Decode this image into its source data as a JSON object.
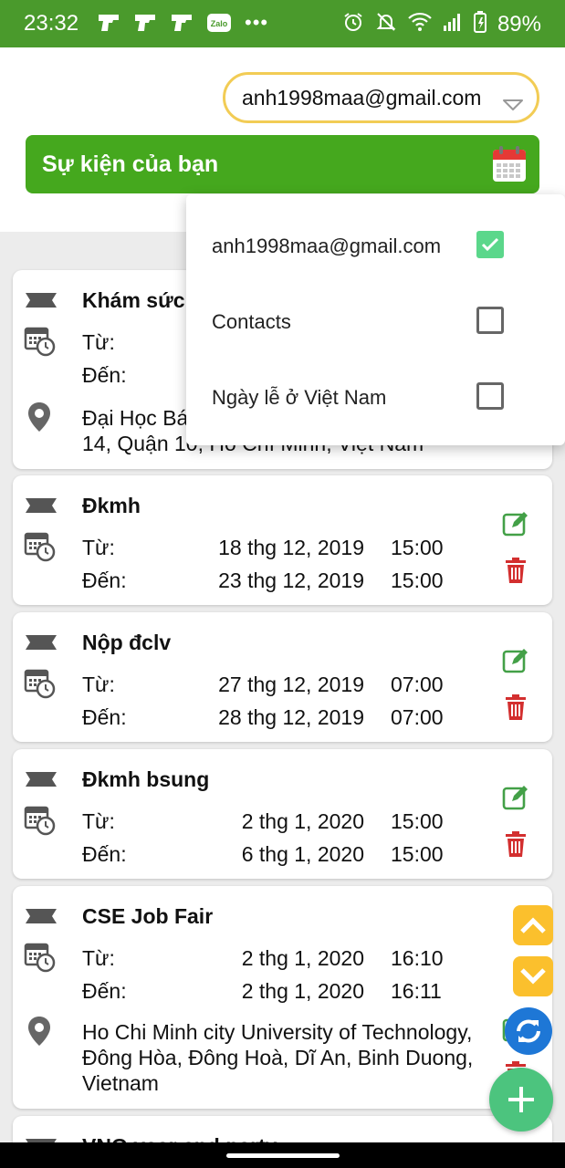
{
  "status_bar": {
    "time": "23:32",
    "battery": "89%",
    "icons": [
      "pistol-icon",
      "pistol-icon",
      "pistol-icon",
      "zalo-icon",
      "more-dots-icon",
      "alarm-icon",
      "mute-icon",
      "wifi-icon",
      "signal-icon",
      "battery-icon"
    ],
    "zalo_label": "Zalo",
    "dots": "•••"
  },
  "header": {
    "account": "anh1998maa@gmail.com",
    "banner_title": "Sự kiện của bạn"
  },
  "menu": {
    "items": [
      {
        "label": "anh1998maa@gmail.com",
        "checked": true
      },
      {
        "label": "Contacts",
        "checked": false
      },
      {
        "label": "Ngày lễ ở Việt Nam",
        "checked": false
      }
    ]
  },
  "events": [
    {
      "title": "Khám sức",
      "from_label": "Từ:",
      "to_label": "Đến:",
      "location": "Đại Học Bá",
      "location2": "14, Quận 10, Hồ Chí Minh, Việt Nam"
    },
    {
      "title": "Đkmh",
      "from_label": "Từ:",
      "from_date": "18 thg 12, 2019",
      "from_time": "15:00",
      "to_label": "Đến:",
      "to_date": "23 thg 12, 2019",
      "to_time": "15:00"
    },
    {
      "title": "Nộp đclv",
      "from_label": "Từ:",
      "from_date": "27 thg 12, 2019",
      "from_time": "07:00",
      "to_label": "Đến:",
      "to_date": "28 thg 12, 2019",
      "to_time": "07:00"
    },
    {
      "title": "Đkmh bsung",
      "from_label": "Từ:",
      "from_date": "2 thg 1, 2020",
      "from_time": "15:00",
      "to_label": "Đến:",
      "to_date": "6 thg 1, 2020",
      "to_time": "15:00"
    },
    {
      "title": "CSE Job Fair",
      "from_label": "Từ:",
      "from_date": "2 thg 1, 2020",
      "from_time": "16:10",
      "to_label": "Đến:",
      "to_date": "2 thg 1, 2020",
      "to_time": "16:11",
      "location": "Ho Chi Minh city University of Technology, Đông Hòa, Đông Hoà, Dĩ An, Binh Duong, Vietnam"
    },
    {
      "title": "VNG year end party"
    }
  ],
  "colors": {
    "primary_green": "#45a81e",
    "status_green": "#4a9a2c",
    "account_border": "#f2cc55",
    "edit_green": "#43a047",
    "delete_red": "#d32f2f",
    "scroll_yellow": "#fbc02d",
    "sync_blue": "#1e77d6",
    "add_green": "#4cc47e"
  }
}
